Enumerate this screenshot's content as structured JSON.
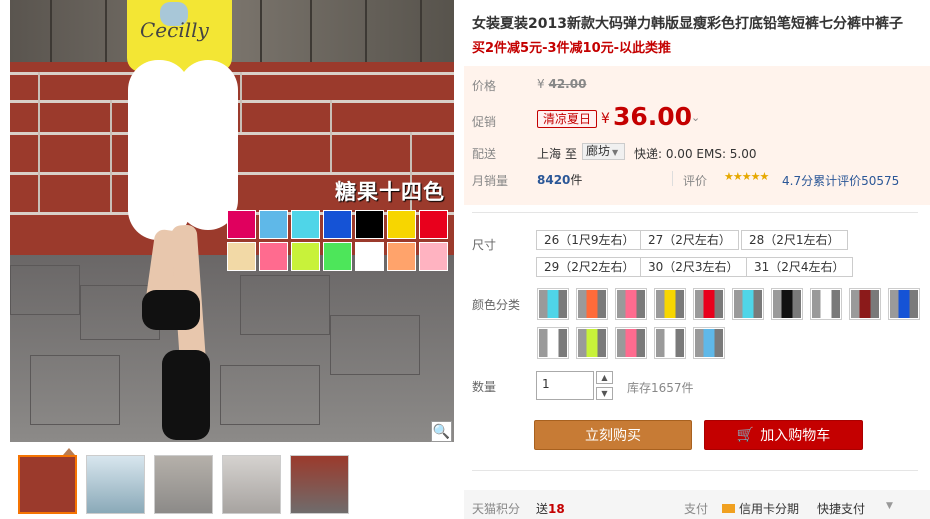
{
  "gallery": {
    "banner_text": "糖果十四色",
    "shirt_text": "Cecilly",
    "swatch_colors": [
      "#e0005e",
      "#5fb8e8",
      "#4fd5e8",
      "#1553d6",
      "#000000",
      "#f7d600",
      "#e8001c",
      "#f2d9a6",
      "#ff6b8f",
      "#c8f23a",
      "#4de65a",
      "#ffffff",
      "#ffa36b",
      "#ffb3c1"
    ],
    "zoom_icon": "magnifier-icon",
    "thumbnails": [
      {
        "color": "#9b3a2c",
        "active": true
      },
      {
        "color": "#8aa9b8",
        "active": false
      },
      {
        "color": "#8c8a88",
        "active": false
      },
      {
        "color": "#a7a3a0",
        "active": false
      },
      {
        "color": "#9b3a2c",
        "active": false
      }
    ]
  },
  "product": {
    "title": "女装夏装2013新款大码弹力韩版显瘦彩色打底铅笔短裤七分裤中裤子",
    "subtitle": "买2件减5元-3件减10元-以此类推"
  },
  "pricing": {
    "price_label": "价格",
    "original_price": "42.00",
    "currency": "¥",
    "promo_label": "促销",
    "promo_tag": "清凉夏日",
    "promo_price": "36.00",
    "shipping_label": "配送",
    "ship_from": "上海",
    "ship_to_word": "至",
    "ship_to": "廊坊",
    "shipping_fees": "快递: 0.00 EMS: 5.00",
    "monthly_label": "月销量",
    "monthly_sales": "8420",
    "monthly_unit": "件",
    "rating_label": "评价",
    "rating_stars": "★★★★★",
    "rating_text": "4.7分累计评价50575"
  },
  "options": {
    "size_label": "尺寸",
    "sizes": [
      "26（1尺9左右）",
      "27（2尺左右）",
      "28（2尺1左右）",
      "29（2尺2左右）",
      "30（2尺3左右）",
      "31（2尺4左右）"
    ],
    "color_label": "颜色分类",
    "colors": [
      "#4fd5e8",
      "#ff6b3a",
      "#ff6b8f",
      "#f7d600",
      "#e8001c",
      "#4fd5e8",
      "#111111",
      "#ffffff",
      "#8b1a1a",
      "#1553d6",
      "#ffffff",
      "#c8f23a",
      "#ff6b8f",
      "#ffffff",
      "#5fb8e8"
    ],
    "qty_label": "数量",
    "qty_value": "1",
    "stock_text": "库存1657件"
  },
  "actions": {
    "buy_now": "立刻购买",
    "add_to_cart": "加入购物车"
  },
  "footer": {
    "points_label": "天猫积分",
    "points_prefix": "送",
    "points_value": "18",
    "pay_label": "支付",
    "credit": "信用卡分期",
    "quick_pay": "快捷支付"
  }
}
